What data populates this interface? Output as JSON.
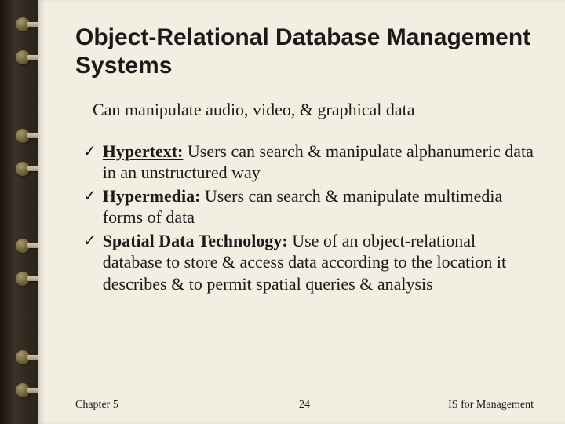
{
  "title": "Object-Relational Database Management Systems",
  "subtitle": "Can manipulate audio, video, & graphical data",
  "bullets": [
    {
      "term": "Hypertext:",
      "underline": true,
      "desc": " Users can search & manipulate alphanumeric data in an unstructured way"
    },
    {
      "term": "Hypermedia:",
      "underline": false,
      "desc": " Users can search & manipulate multimedia forms of data"
    },
    {
      "term": "Spatial Data Technology:",
      "underline": false,
      "desc": " Use of an object-relational database to store & access data according to the location it describes & to permit spatial queries & analysis"
    }
  ],
  "footer": {
    "left": "Chapter 5",
    "center": "24",
    "right": "IS for Management"
  },
  "ring_positions": [
    18,
    60,
    160,
    202,
    300,
    342,
    442,
    484
  ]
}
